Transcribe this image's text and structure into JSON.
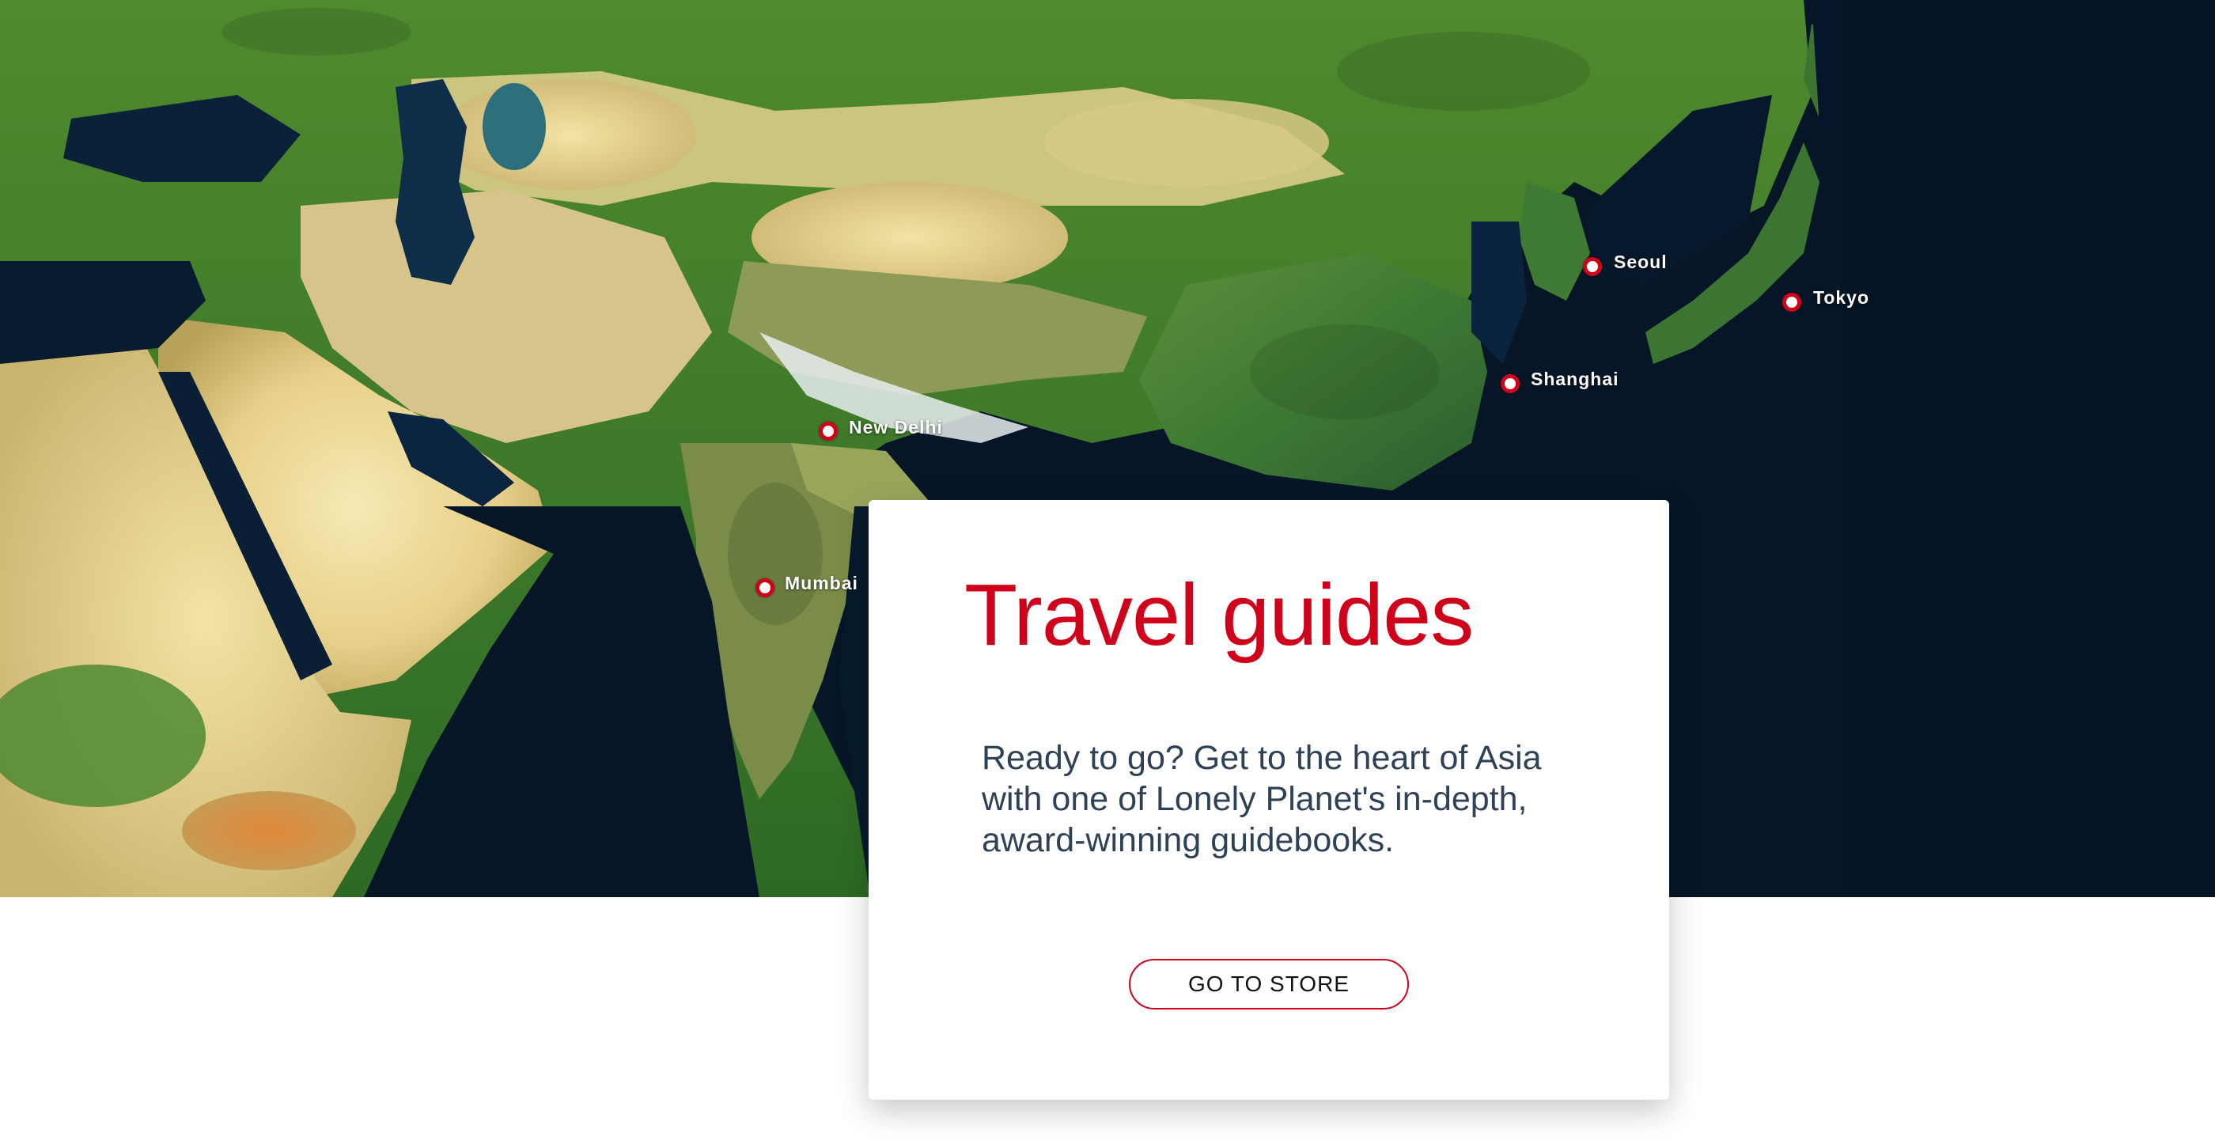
{
  "map": {
    "cities": [
      {
        "name": "Seoul"
      },
      {
        "name": "Tokyo"
      },
      {
        "name": "Shanghai"
      },
      {
        "name": "New Delhi"
      },
      {
        "name": "Mumbai"
      }
    ],
    "pin_color": "#d0021b"
  },
  "card": {
    "title": "Travel guides",
    "description": "Ready to go? Get to the heart of Asia with one of Lonely Planet's in-depth, award-winning guidebooks.",
    "button_label": "GO TO STORE"
  },
  "colors": {
    "accent": "#d0021b",
    "text": "#2f4157",
    "ocean": "#061627"
  }
}
